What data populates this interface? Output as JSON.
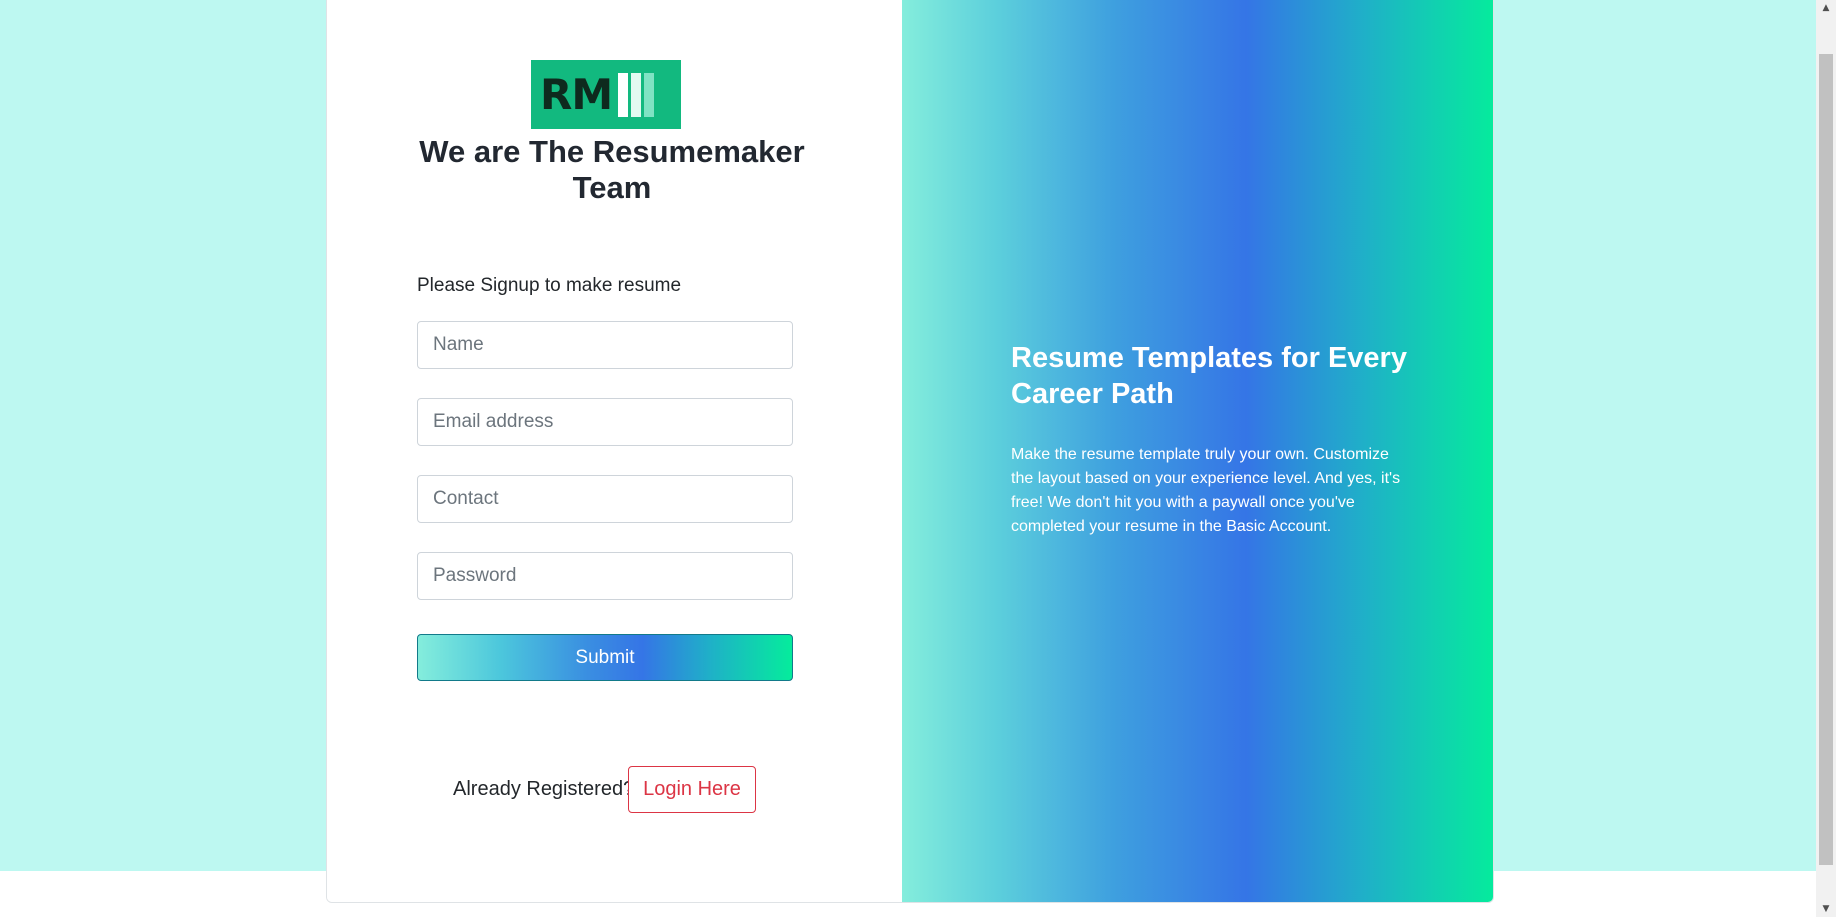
{
  "brand": {
    "logo_text": "RM",
    "title": "We are The Resumemaker Team"
  },
  "signup": {
    "prompt": "Please Signup to make resume",
    "name_placeholder": "Name",
    "email_placeholder": "Email address",
    "contact_placeholder": "Contact",
    "password_placeholder": "Password",
    "submit_label": "Submit",
    "already_text": "Already Registered?",
    "login_label": "Login Here"
  },
  "promo": {
    "title": "Resume Templates for Every Career Path",
    "text": "Make the resume template truly your own. Customize the layout based on your experience level. And yes, it's free! We don't hit you with a paywall once you've completed your resume in the Basic Account."
  },
  "colors": {
    "page_background": "#bdf8f1",
    "logo_green": "#12b97f",
    "login_red": "#dc3545",
    "gradient_start": "#84eddc",
    "gradient_mid": "#3575e6",
    "gradient_end": "#05ec9c"
  },
  "icons": {
    "scroll_up": "scroll-up-arrow-icon",
    "scroll_down": "scroll-down-arrow-icon"
  }
}
